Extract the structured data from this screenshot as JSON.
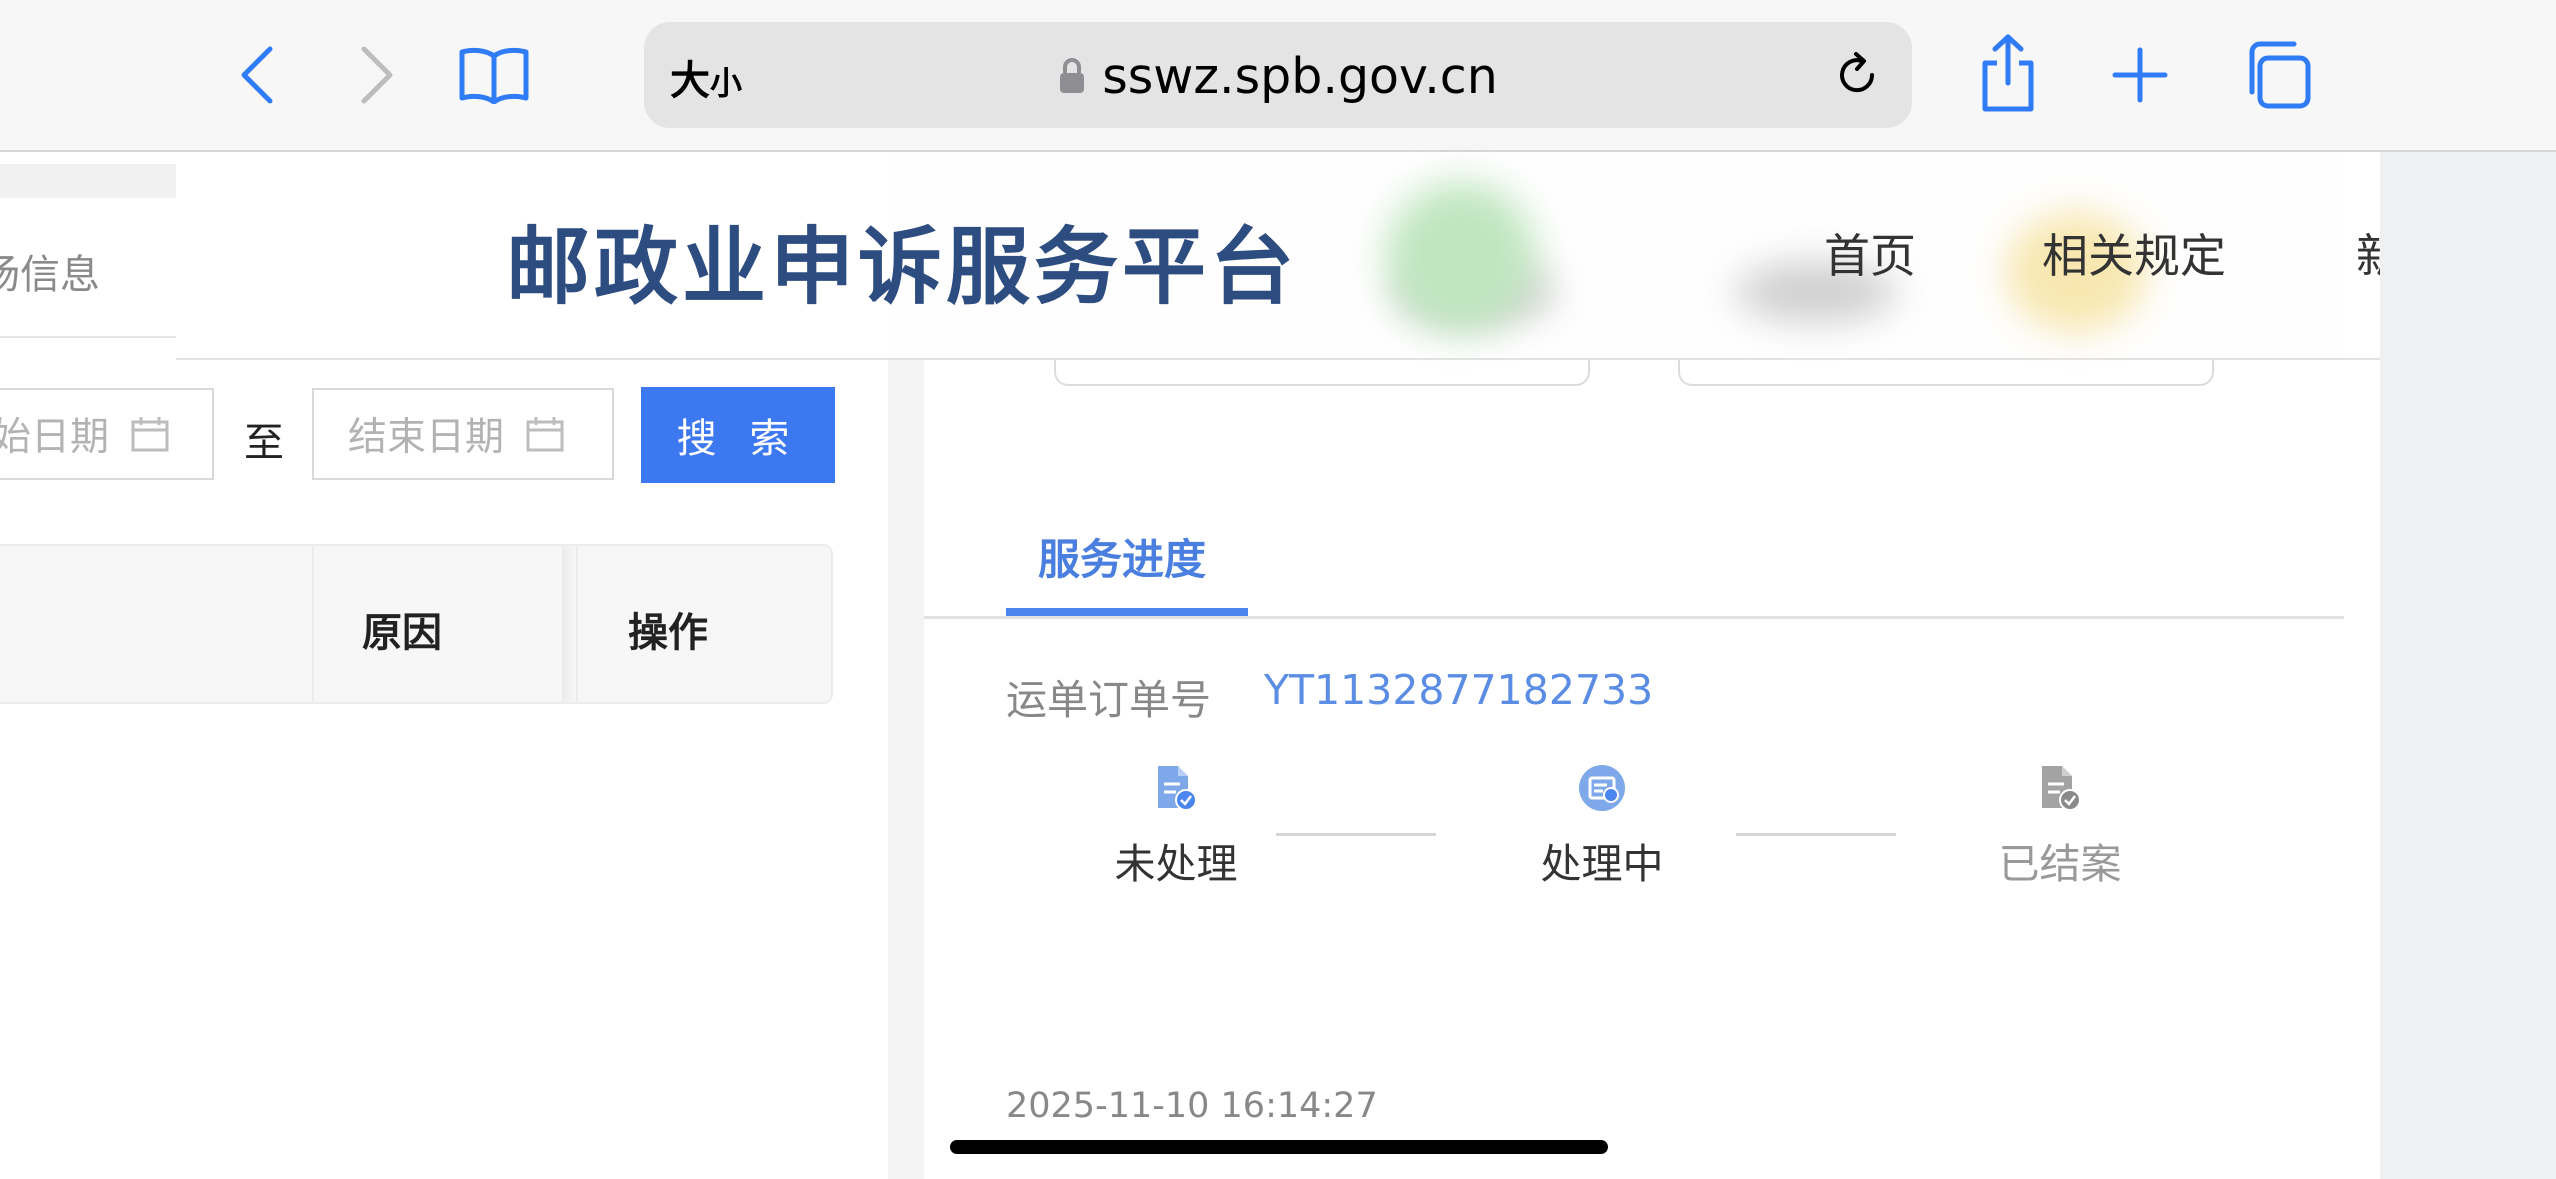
{
  "browser": {
    "text_size_label_big": "大",
    "text_size_label_small": "小",
    "url": "sswz.spb.gov.cn"
  },
  "site": {
    "title": "邮政业申诉服务平台",
    "nav": [
      "首页",
      "相关规定",
      "新"
    ]
  },
  "left": {
    "nav_partial": "扬信息",
    "start_date_placeholder": "始日期",
    "to_label": "至",
    "end_date_placeholder": "结束日期",
    "search_button": "搜 索",
    "table_headers": {
      "reason": "原因",
      "action": "操作"
    }
  },
  "progress": {
    "tab": "服务进度",
    "order_label": "运单订单号",
    "order_number": "YT1132877182733",
    "steps": [
      {
        "label": "未处理",
        "icon": "document-check-icon",
        "state": "done"
      },
      {
        "label": "处理中",
        "icon": "processing-icon",
        "state": "active"
      },
      {
        "label": "已结案",
        "icon": "document-closed-icon",
        "state": "pending"
      }
    ],
    "timestamp": "2025-11-10 16:14:27"
  },
  "colors": {
    "accent": "#3c78f0",
    "title": "#2d4c80",
    "link": "#5b8de4",
    "safari_blue": "#2f7cf6"
  }
}
